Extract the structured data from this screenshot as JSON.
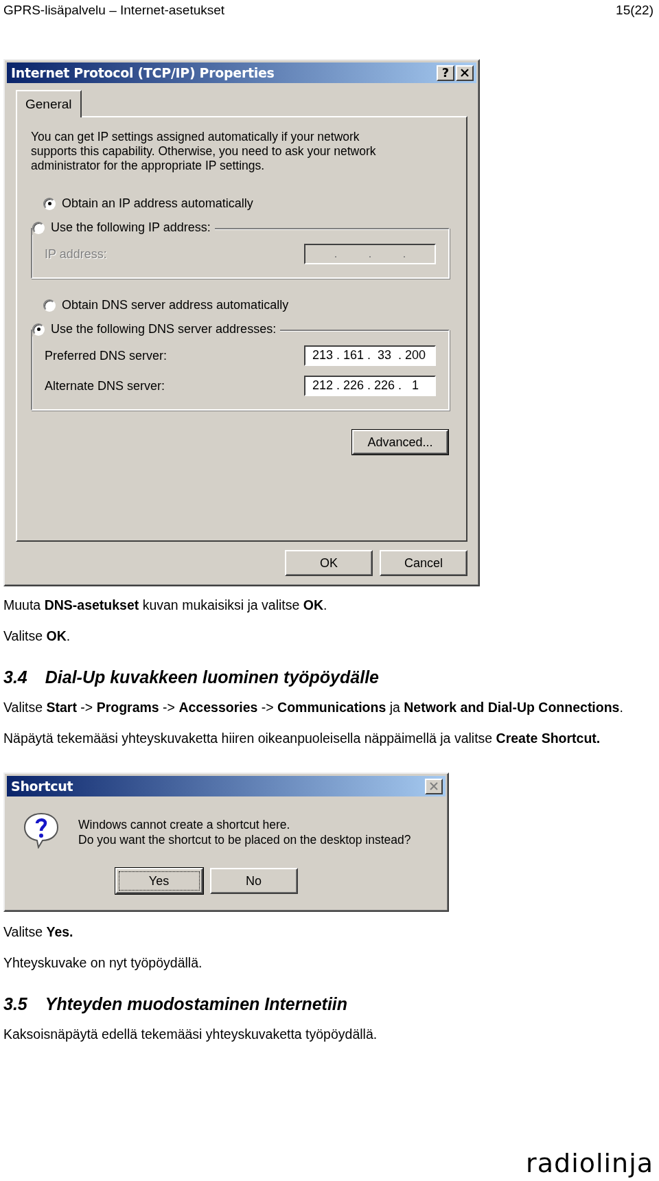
{
  "header": {
    "title": "GPRS-lisäpalvelu – Internet-asetukset",
    "page": "15(22)"
  },
  "tcpip_dialog": {
    "title": "Internet Protocol (TCP/IP) Properties",
    "help": "?",
    "tabs": [
      {
        "label": "General",
        "selected": true
      }
    ],
    "intro": "You can get IP settings assigned automatically if your network supports this capability. Otherwise, you need to ask your network administrator for the appropriate IP settings.",
    "sections": [
      {
        "options": [
          {
            "label": "Obtain an IP address automatically",
            "selected": true
          },
          {
            "label": "Use the following IP address:",
            "selected": false
          }
        ],
        "fields": [
          {
            "label": "IP address:",
            "value": ".         .         .",
            "disabled": true
          }
        ]
      },
      {
        "options": [
          {
            "label": "Obtain DNS server address automatically",
            "selected": false
          },
          {
            "label": "Use the following DNS server addresses:",
            "selected": true
          }
        ],
        "fields": [
          {
            "label": "Preferred DNS server:",
            "value": "213 . 161 .  33  . 200",
            "disabled": false
          },
          {
            "label": "Alternate DNS server:",
            "value": "212 . 226 . 226 .   1",
            "disabled": false
          }
        ]
      }
    ],
    "advanced_button": "Advanced...",
    "buttons": [
      "OK",
      "Cancel"
    ]
  },
  "paragraphs_1": [
    "Muuta **DNS-asetukset** kuvan mukaisiksi ja valitse **OK**.",
    "Valitse **OK**."
  ],
  "heading_1": {
    "number": "3.4",
    "title": "Dial-Up kuvakkeen luominen työpöydälle"
  },
  "paragraphs_2": [
    "Valitse **Start** -> **Programs** -> **Accessories** -> **Communications** ja **Network and Dial-Up Connections**.",
    "Näpäytä tekemääsi yhteyskuvaketta hiiren oikeanpuoleisella näppäimellä ja valitse **Create Shortcut.**"
  ],
  "shortcut_dialog": {
    "title": "Shortcut",
    "message": [
      "Windows cannot create a shortcut here.",
      "Do you want the shortcut to be placed on the desktop instead?"
    ],
    "buttons": [
      {
        "label": "Yes",
        "focused": true
      },
      {
        "label": "No",
        "focused": false
      }
    ]
  },
  "paragraphs_3": [
    "Valitse **Yes.**",
    "Yhteyskuvake on nyt työpöydällä."
  ],
  "heading_2": {
    "number": "3.5",
    "title": "Yhteyden muodostaminen Internetiin"
  },
  "paragraphs_4": [
    "Kaksoisnäpäytä edellä tekemääsi yhteyskuvaketta työpöydällä."
  ],
  "logo": "radiolinja"
}
